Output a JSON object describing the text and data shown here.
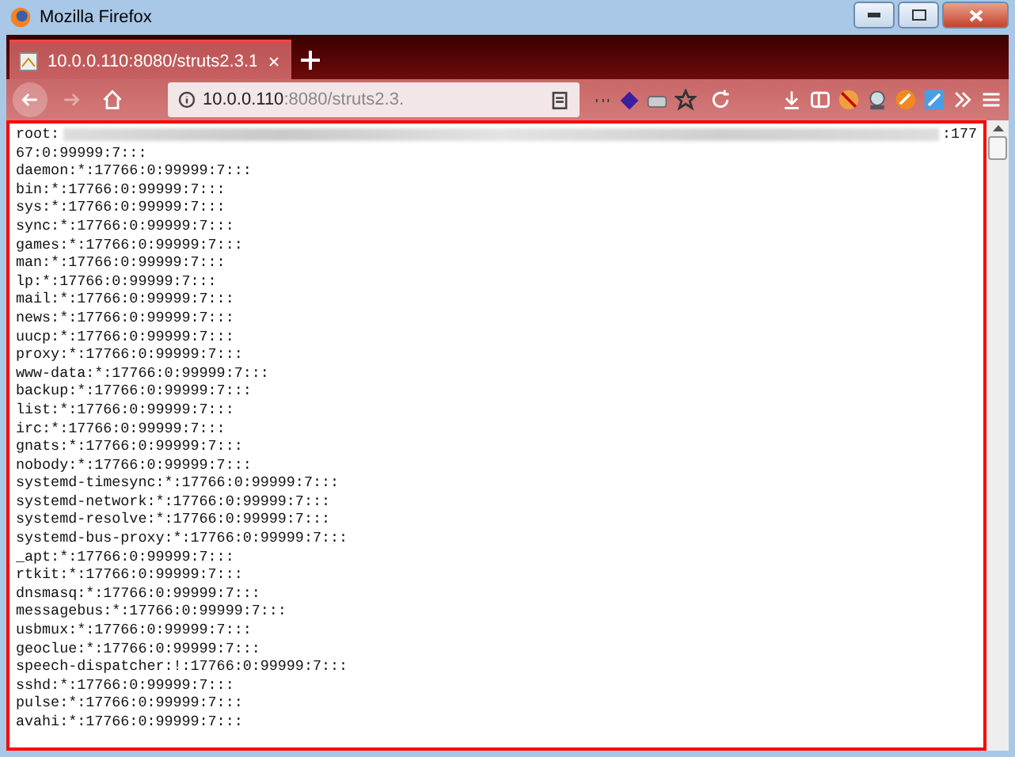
{
  "window": {
    "title": "Mozilla Firefox"
  },
  "tabs": [
    {
      "title": "10.0.0.110:8080/struts2.3.1",
      "selected": true
    }
  ],
  "toolbar": {
    "back": {
      "disabled": false
    },
    "forward": {
      "disabled": true
    },
    "url_host": "10.0.0.110",
    "url_rest": ":8080/struts2.3."
  },
  "lines": [
    {
      "kind": "redacted",
      "prefix": "root:",
      "suffix": ":177"
    },
    {
      "kind": "text",
      "text": "67:0:99999:7:::"
    },
    {
      "kind": "text",
      "text": "daemon:*:17766:0:99999:7:::"
    },
    {
      "kind": "text",
      "text": "bin:*:17766:0:99999:7:::"
    },
    {
      "kind": "text",
      "text": "sys:*:17766:0:99999:7:::"
    },
    {
      "kind": "text",
      "text": "sync:*:17766:0:99999:7:::"
    },
    {
      "kind": "text",
      "text": "games:*:17766:0:99999:7:::"
    },
    {
      "kind": "text",
      "text": "man:*:17766:0:99999:7:::"
    },
    {
      "kind": "text",
      "text": "lp:*:17766:0:99999:7:::"
    },
    {
      "kind": "text",
      "text": "mail:*:17766:0:99999:7:::"
    },
    {
      "kind": "text",
      "text": "news:*:17766:0:99999:7:::"
    },
    {
      "kind": "text",
      "text": "uucp:*:17766:0:99999:7:::"
    },
    {
      "kind": "text",
      "text": "proxy:*:17766:0:99999:7:::"
    },
    {
      "kind": "text",
      "text": "www-data:*:17766:0:99999:7:::"
    },
    {
      "kind": "text",
      "text": "backup:*:17766:0:99999:7:::"
    },
    {
      "kind": "text",
      "text": "list:*:17766:0:99999:7:::"
    },
    {
      "kind": "text",
      "text": "irc:*:17766:0:99999:7:::"
    },
    {
      "kind": "text",
      "text": "gnats:*:17766:0:99999:7:::"
    },
    {
      "kind": "text",
      "text": "nobody:*:17766:0:99999:7:::"
    },
    {
      "kind": "text",
      "text": "systemd-timesync:*:17766:0:99999:7:::"
    },
    {
      "kind": "text",
      "text": "systemd-network:*:17766:0:99999:7:::"
    },
    {
      "kind": "text",
      "text": "systemd-resolve:*:17766:0:99999:7:::"
    },
    {
      "kind": "text",
      "text": "systemd-bus-proxy:*:17766:0:99999:7:::"
    },
    {
      "kind": "text",
      "text": "_apt:*:17766:0:99999:7:::"
    },
    {
      "kind": "text",
      "text": "rtkit:*:17766:0:99999:7:::"
    },
    {
      "kind": "text",
      "text": "dnsmasq:*:17766:0:99999:7:::"
    },
    {
      "kind": "text",
      "text": "messagebus:*:17766:0:99999:7:::"
    },
    {
      "kind": "text",
      "text": "usbmux:*:17766:0:99999:7:::"
    },
    {
      "kind": "text",
      "text": "geoclue:*:17766:0:99999:7:::"
    },
    {
      "kind": "text",
      "text": "speech-dispatcher:!:17766:0:99999:7:::"
    },
    {
      "kind": "text",
      "text": "sshd:*:17766:0:99999:7:::"
    },
    {
      "kind": "text",
      "text": "pulse:*:17766:0:99999:7:::"
    },
    {
      "kind": "text",
      "text": "avahi:*:17766:0:99999:7:::"
    }
  ]
}
